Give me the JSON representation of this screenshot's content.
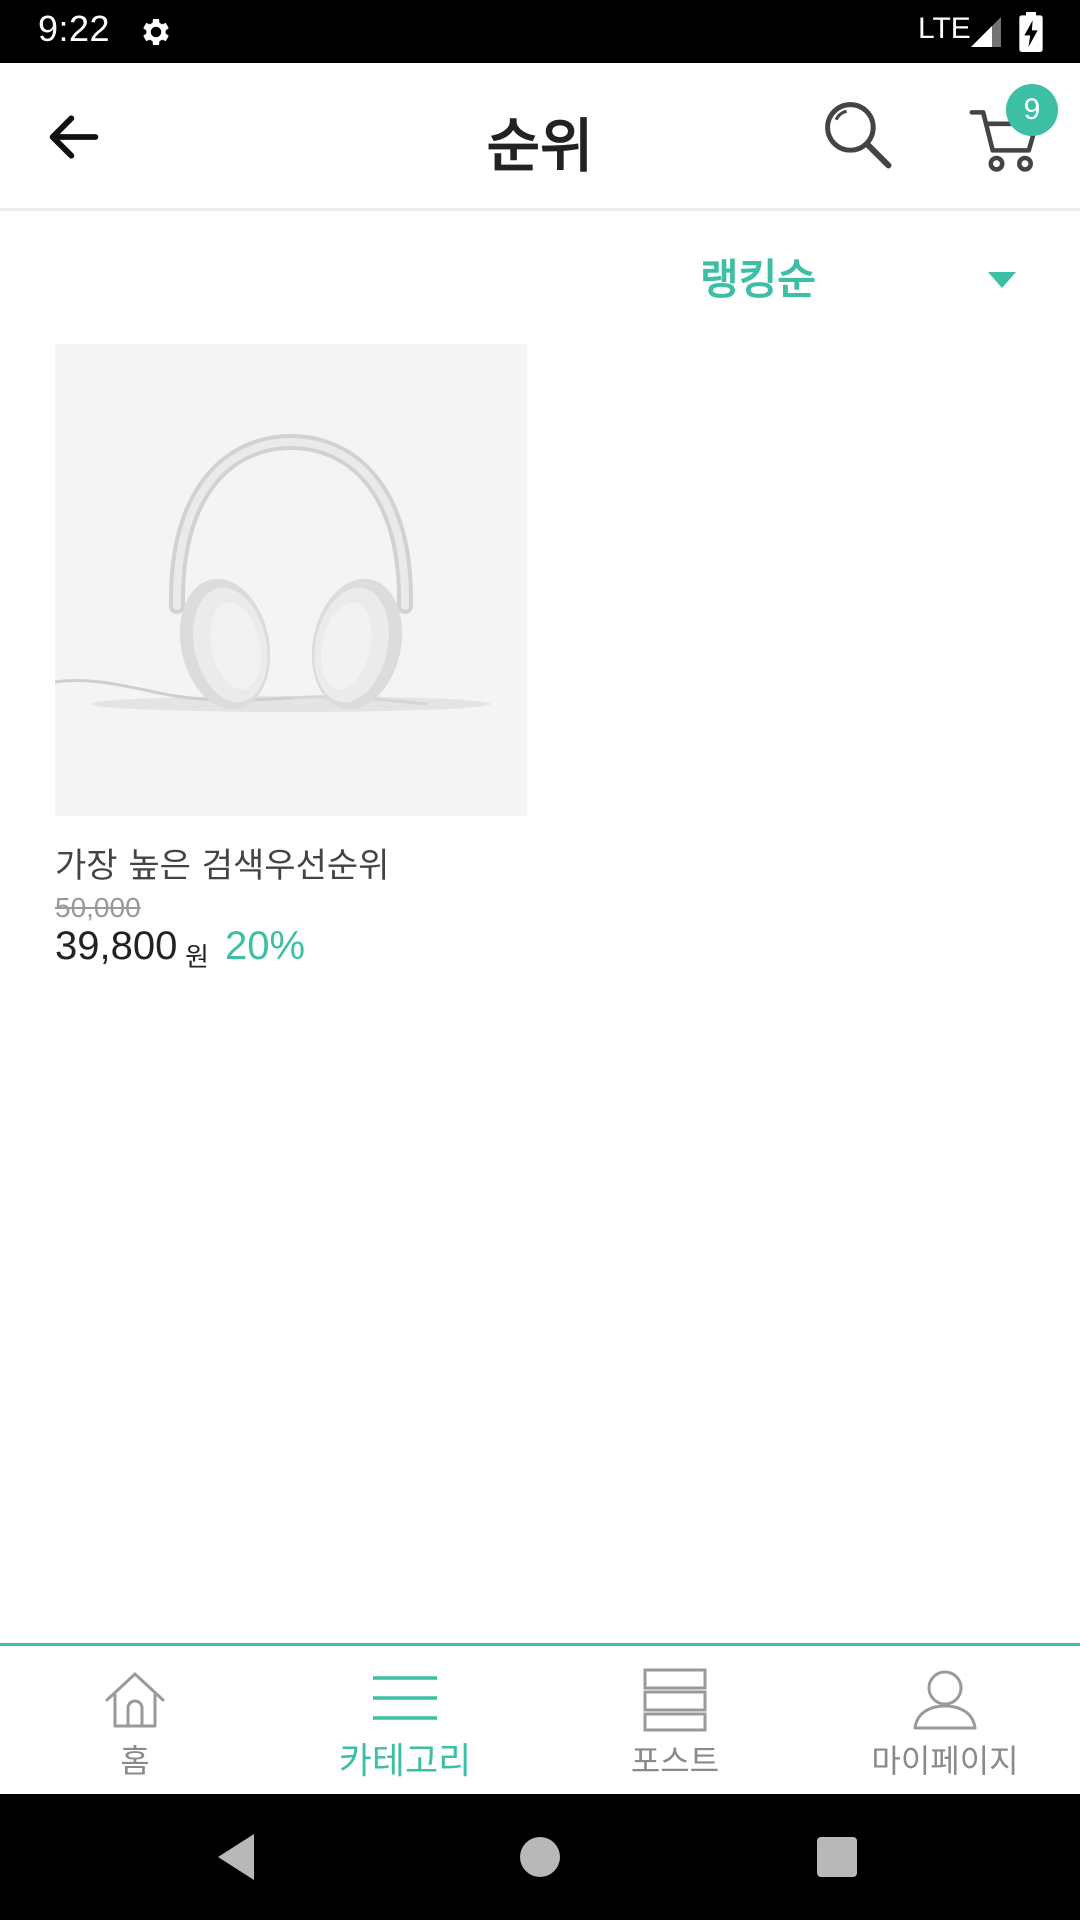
{
  "status_bar": {
    "time": "9:22",
    "network": "LTE"
  },
  "app_bar": {
    "title": "순위",
    "cart_count": "9"
  },
  "sort": {
    "selected": "랭킹순"
  },
  "products": [
    {
      "name": "가장 높은 검색우선순위",
      "original_price": "50,000",
      "price": "39,800",
      "currency": "원",
      "discount": "20%"
    }
  ],
  "bottom_nav": {
    "items": [
      {
        "label": "홈",
        "icon": "home-icon"
      },
      {
        "label": "카테고리",
        "icon": "menu-icon"
      },
      {
        "label": "포스트",
        "icon": "post-icon"
      },
      {
        "label": "마이페이지",
        "icon": "person-icon"
      }
    ],
    "active": "카테고리"
  },
  "colors": {
    "accent": "#3dbfa5",
    "text_primary": "#222222",
    "text_muted": "#8a8a8a"
  }
}
